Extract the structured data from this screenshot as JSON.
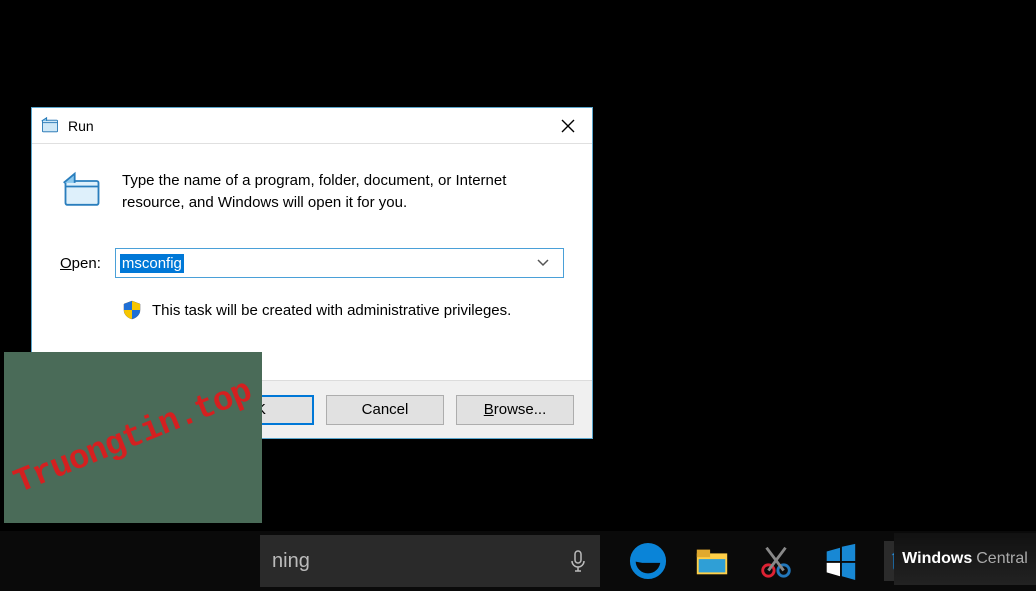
{
  "dialog": {
    "title": "Run",
    "description": "Type the name of a program, folder, document, or Internet resource, and Windows will open it for you.",
    "open_label_prefix": "O",
    "open_label_rest": "pen:",
    "input_value": "msconfig",
    "priv_text": "This task will be created with administrative privileges.",
    "buttons": {
      "ok": "OK",
      "cancel": "Cancel",
      "browse_prefix": "B",
      "browse_rest": "rowse..."
    }
  },
  "watermark": "Truongtin.top",
  "taskbar": {
    "search_fragment": "ning",
    "icons": {
      "edge": "edge-icon",
      "explorer": "file-explorer-icon",
      "snip": "snipping-tool-icon",
      "app": "app-icon",
      "run": "run-icon"
    }
  },
  "brand": {
    "name": "Windows",
    "suffix": "Central"
  }
}
